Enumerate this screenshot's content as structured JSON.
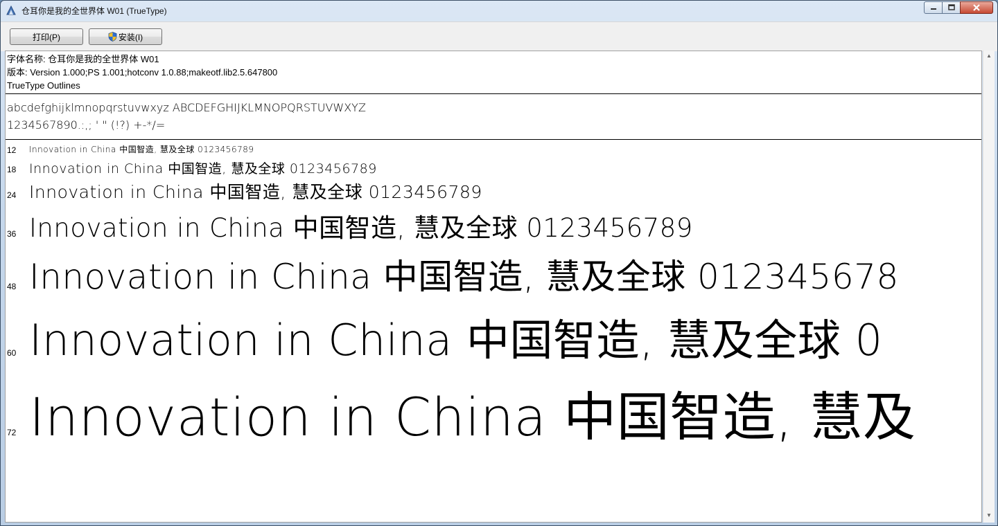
{
  "window": {
    "title": "仓耳你是我的全世界体 W01 (TrueType)",
    "app_icon": "font-viewer-icon",
    "controls": {
      "minimize": "minimize-icon",
      "maximize": "maximize-icon",
      "close": "close-icon"
    }
  },
  "toolbar": {
    "print_label": "打印(P)",
    "install_label": "安装(I)",
    "install_icon": "uac-shield-icon"
  },
  "info": {
    "font_name_line": "字体名称: 仓耳你是我的全世界体 W01",
    "version_line": "版本: Version 1.000;PS 1.001;hotconv 1.0.88;makeotf.lib2.5.647800",
    "outline_line": "TrueType Outlines"
  },
  "charset": {
    "line1": "abcdefghijklmnopqrstuvwxyz ABCDEFGHIJKLMNOPQRSTUVWXYZ",
    "line2": "1234567890.:,; ' \" (!?) +-*/="
  },
  "samples": [
    {
      "size": "12",
      "text": "Innovation in China 中国智造, 慧及全球 0123456789"
    },
    {
      "size": "18",
      "text": "Innovation in China 中国智造, 慧及全球 0123456789"
    },
    {
      "size": "24",
      "text": "Innovation in China 中国智造, 慧及全球 0123456789"
    },
    {
      "size": "36",
      "text": "Innovation in China 中国智造, 慧及全球 0123456789"
    },
    {
      "size": "48",
      "text": "Innovation in China 中国智造, 慧及全球 012345678"
    },
    {
      "size": "60",
      "text": "Innovation in China 中国智造, 慧及全球 0"
    },
    {
      "size": "72",
      "text": "Innovation in China 中国智造, 慧及"
    }
  ]
}
